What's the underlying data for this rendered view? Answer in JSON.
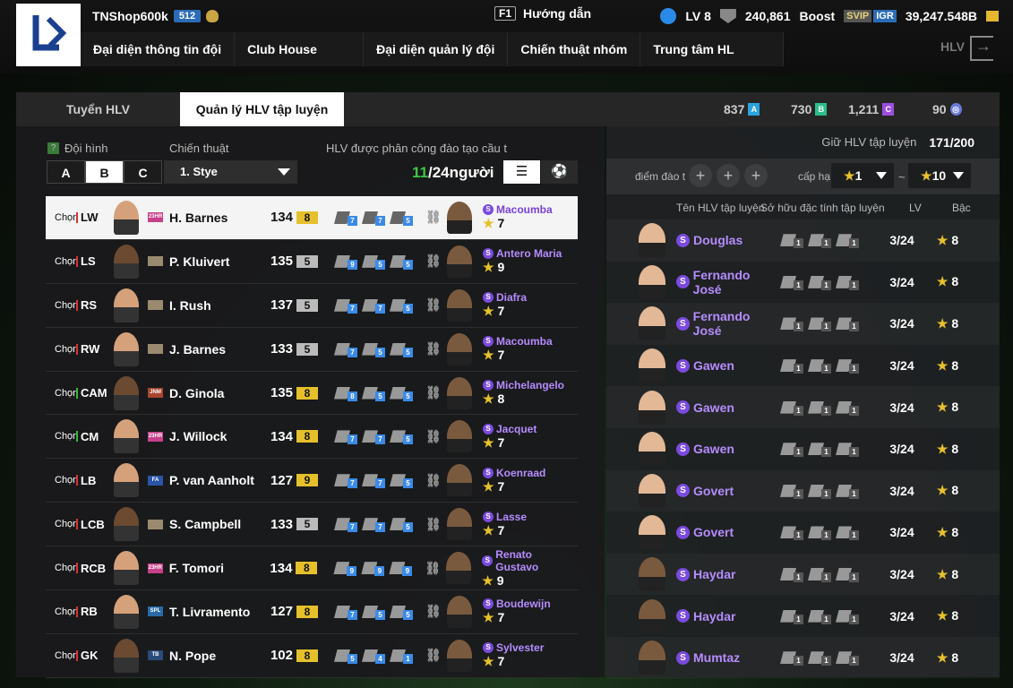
{
  "topbar": {
    "username": "TNShop600k",
    "level_badge": "512",
    "help_key": "F1",
    "help_label": "Hướng dẫn",
    "lv": "LV 8",
    "shield_value": "240,861",
    "boost": "Boost",
    "svip": "SVIP",
    "igr": "IGR",
    "balance": "39,247.548B"
  },
  "nav": [
    "Đại diện thông tin đội",
    "Club House",
    "Đại diện quản lý đội",
    "Chiến thuật nhóm",
    "Trung tâm HL"
  ],
  "nav_right": "HLV",
  "tabs": [
    "Tuyển HLV",
    "Quản lý HLV tập luyện"
  ],
  "resources": [
    {
      "value": "837",
      "tag": "A",
      "color": "#2aa3e0"
    },
    {
      "value": "730",
      "tag": "B",
      "color": "#2bbf8a"
    },
    {
      "value": "1,211",
      "tag": "C",
      "color": "#9b4ee0"
    },
    {
      "value": "90",
      "tag": "◎",
      "color": "#6a7ad8"
    }
  ],
  "left": {
    "formation_icon": "?",
    "formation_label": "Đội hình",
    "tactic_label": "Chiến thuật",
    "assigned_label": "HLV được phân công đào tạo cầu t",
    "formations": [
      "A",
      "B",
      "C"
    ],
    "tactic_value": "1. Stye",
    "count_current": "11",
    "count_rest": "/24người"
  },
  "players": [
    {
      "chon": "Chọn",
      "pos": "LW",
      "card": "23HR",
      "card_color": "#c8408a",
      "name": "H. Barnes",
      "ovr": "134",
      "level": "8",
      "badge": "y",
      "traits": [
        "7",
        "7",
        "5"
      ],
      "coach": "Macoumba",
      "coach_star": "7",
      "hl": true,
      "gpos": false
    },
    {
      "chon": "Chọn",
      "pos": "LS",
      "card": "",
      "card_color": "#9a8a70",
      "name": "P. Kluivert",
      "ovr": "135",
      "level": "5",
      "badge": "gr",
      "traits": [
        "9",
        "5",
        "5"
      ],
      "coach": "Antero Maria",
      "coach_star": "9",
      "gpos": false
    },
    {
      "chon": "Chọn",
      "pos": "RS",
      "card": "",
      "card_color": "#9a8a70",
      "name": "I. Rush",
      "ovr": "137",
      "level": "5",
      "badge": "gr",
      "traits": [
        "7",
        "7",
        "5"
      ],
      "coach": "Diafra",
      "coach_star": "7",
      "gpos": false
    },
    {
      "chon": "Chọn",
      "pos": "RW",
      "card": "",
      "card_color": "#9a8a70",
      "name": "J. Barnes",
      "ovr": "133",
      "level": "5",
      "badge": "gr",
      "traits": [
        "7",
        "5",
        "5"
      ],
      "coach": "Macoumba",
      "coach_star": "7",
      "gpos": false
    },
    {
      "chon": "Chọn",
      "pos": "CAM",
      "card": "JNM",
      "card_color": "#a8462f",
      "name": "D. Ginola",
      "ovr": "135",
      "level": "8",
      "badge": "y",
      "traits": [
        "8",
        "5",
        "5"
      ],
      "coach": "Michelangelo",
      "coach_star": "8",
      "gpos": true
    },
    {
      "chon": "Chọn",
      "pos": "CM",
      "card": "23HR",
      "card_color": "#c8408a",
      "name": "J. Willock",
      "ovr": "134",
      "level": "8",
      "badge": "y",
      "traits": [
        "7",
        "7",
        "5"
      ],
      "coach": "Jacquet",
      "coach_star": "7",
      "gpos": true
    },
    {
      "chon": "Chọn",
      "pos": "LB",
      "card": "FA",
      "card_color": "#2a55a8",
      "name": "P. van Aanholt",
      "ovr": "127",
      "level": "9",
      "badge": "y",
      "traits": [
        "7",
        "7",
        "5"
      ],
      "coach": "Koenraad",
      "coach_star": "7",
      "gpos": false
    },
    {
      "chon": "Chọn",
      "pos": "LCB",
      "card": "",
      "card_color": "#9a8a70",
      "name": "S. Campbell",
      "ovr": "133",
      "level": "5",
      "badge": "gr",
      "traits": [
        "7",
        "7",
        "5"
      ],
      "coach": "Lasse",
      "coach_star": "7",
      "gpos": false
    },
    {
      "chon": "Chọn",
      "pos": "RCB",
      "card": "23HR",
      "card_color": "#c8408a",
      "name": "F. Tomori",
      "ovr": "134",
      "level": "8",
      "badge": "y",
      "traits": [
        "9",
        "9",
        "9"
      ],
      "coach": "Renato Gustavo",
      "coach_star": "9",
      "gpos": false
    },
    {
      "chon": "Chọn",
      "pos": "RB",
      "card": "SPL",
      "card_color": "#2a6aa8",
      "name": "T. Livramento",
      "ovr": "127",
      "level": "8",
      "badge": "y",
      "traits": [
        "7",
        "5",
        "5"
      ],
      "coach": "Boudewijn",
      "coach_star": "7",
      "gpos": false
    },
    {
      "chon": "Chọn",
      "pos": "GK",
      "card": "TB",
      "card_color": "#2a4a7a",
      "name": "N. Pope",
      "ovr": "102",
      "level": "8",
      "badge": "y",
      "traits": [
        "5",
        "4",
        "1"
      ],
      "coach": "Sylvester",
      "coach_star": "7",
      "gpos": false
    }
  ],
  "right": {
    "hold_label": "Giữ HLV tập luyện",
    "hold_value": "171/200",
    "points_label": "điểm đào t",
    "level_label": "cấp hạ",
    "level_from": "1",
    "level_to": "10",
    "tilde": "~",
    "col_name": "Tên HLV tập luyện",
    "col_traits": "Sở hữu đặc tính tập luyện",
    "col_lv": "LV",
    "col_rank": "Bậc"
  },
  "coaches": [
    {
      "name": "Douglas",
      "lv": "3/24",
      "rank": "8",
      "skin": "lt"
    },
    {
      "name": "Fernando José",
      "lv": "3/24",
      "rank": "8",
      "skin": "lt"
    },
    {
      "name": "Fernando José",
      "lv": "3/24",
      "rank": "8",
      "skin": "lt"
    },
    {
      "name": "Gawen",
      "lv": "3/24",
      "rank": "8",
      "skin": "lt"
    },
    {
      "name": "Gawen",
      "lv": "3/24",
      "rank": "8",
      "skin": "lt"
    },
    {
      "name": "Gawen",
      "lv": "3/24",
      "rank": "8",
      "skin": "lt"
    },
    {
      "name": "Govert",
      "lv": "3/24",
      "rank": "8",
      "skin": "lt"
    },
    {
      "name": "Govert",
      "lv": "3/24",
      "rank": "8",
      "skin": "lt"
    },
    {
      "name": "Haydar",
      "lv": "3/24",
      "rank": "8",
      "skin": "dk"
    },
    {
      "name": "Haydar",
      "lv": "3/24",
      "rank": "8",
      "skin": "dk"
    },
    {
      "name": "Mumtaz",
      "lv": "3/24",
      "rank": "8",
      "skin": "dk"
    }
  ],
  "coach_trait_level": "1"
}
